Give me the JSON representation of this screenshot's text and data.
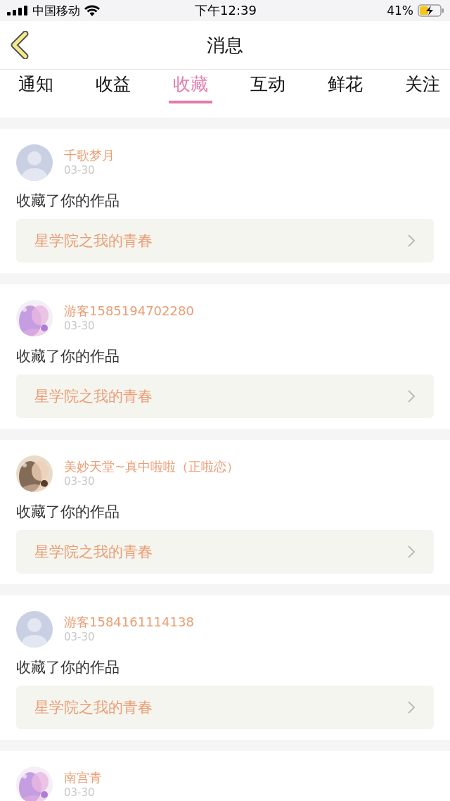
{
  "status_bar": {
    "carrier": "中国移动",
    "time": "下午12:39",
    "battery": "41%",
    "charging": true
  },
  "header": {
    "title": "消息"
  },
  "tabs": [
    {
      "label": "通知",
      "selected": false
    },
    {
      "label": "收益",
      "selected": false
    },
    {
      "label": "收藏",
      "selected": true
    },
    {
      "label": "互动",
      "selected": false
    },
    {
      "label": "鲜花",
      "selected": false
    },
    {
      "label": "关注",
      "selected": false
    }
  ],
  "messages": [
    {
      "avatar": {
        "kind": "default"
      },
      "name": "千歌梦月",
      "date": "03-30",
      "text": "收藏了你的作品",
      "work": "星学院之我的青春"
    },
    {
      "name": "游客1585194702280",
      "date": "03-30",
      "text": "收藏了你的作品",
      "work": "星学院之我的青春"
    },
    {
      "name": "美妙天堂~真中啦啦（正啦恋）",
      "date": "03-30",
      "text": "收藏了你的作品",
      "work": "星学院之我的青春"
    },
    {
      "avatar": {
        "kind": "default"
      },
      "name": "游客1584161114138",
      "date": "03-30",
      "text": "收藏了你的作品",
      "work": "星学院之我的青春"
    },
    {
      "name": "南宫青",
      "date": "03-30"
    }
  ]
}
